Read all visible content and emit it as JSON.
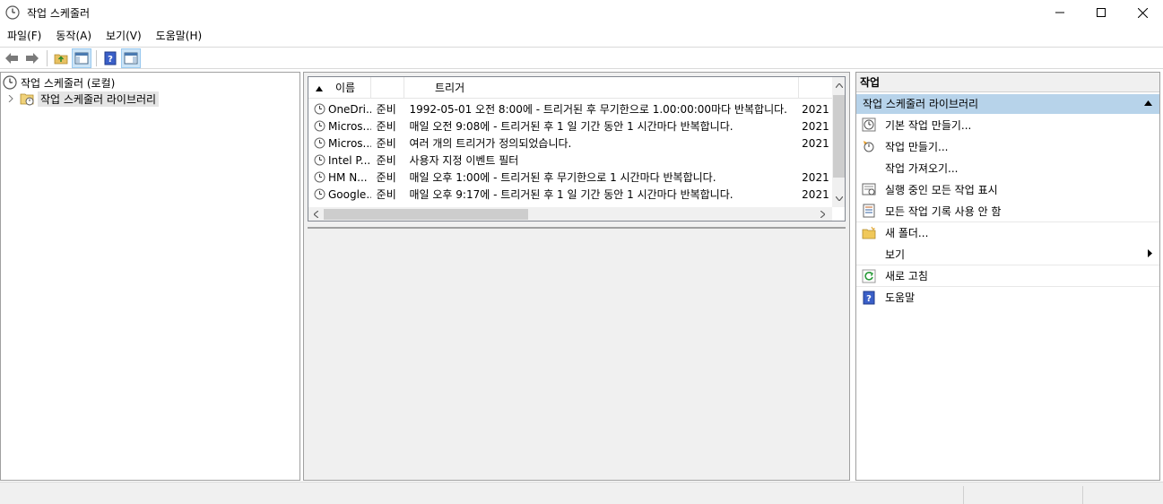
{
  "window": {
    "title": "작업 스케줄러",
    "icon": "clock-icon"
  },
  "menu": [
    "파일(F)",
    "동작(A)",
    "보기(V)",
    "도움말(H)"
  ],
  "toolbar": {
    "buttons": [
      "back-arrow-icon",
      "forward-arrow-icon",
      "up-folder-icon",
      "show-hide-tree-icon",
      "help-icon",
      "show-hide-action-pane-icon"
    ]
  },
  "tree": {
    "root": "작업 스케줄러 (로컬)",
    "library": "작업 스케줄러 라이브러리"
  },
  "task_list": {
    "columns": [
      "이름",
      "트리거"
    ],
    "rows": [
      {
        "name": "OneDri...",
        "status": "준비",
        "trigger": "1992-05-01 오전 8:00에 - 트리거된 후 무기한으로 1.00:00:00마다 반복합니다.",
        "next": "2021"
      },
      {
        "name": "Micros...",
        "status": "준비",
        "trigger": "매일 오전 9:08에 - 트리거된 후 1 일 기간 동안 1 시간마다 반복합니다.",
        "next": "2021"
      },
      {
        "name": "Micros...",
        "status": "준비",
        "trigger": "여러 개의 트리거가 정의되었습니다.",
        "next": "2021"
      },
      {
        "name": "Intel P...",
        "status": "준비",
        "trigger": "사용자 지정 이벤트 필터",
        "next": ""
      },
      {
        "name": "HM N...",
        "status": "준비",
        "trigger": "매일 오후 1:00에 - 트리거된 후 무기한으로 1 시간마다 반복합니다.",
        "next": "2021"
      },
      {
        "name": "Google...",
        "status": "준비",
        "trigger": "매일 오후 9:17에 - 트리거된 후 1 일 기간 동안 1 시간마다 반복합니다.",
        "next": "2021"
      }
    ]
  },
  "actions": {
    "header": "작업",
    "section": "작업 스케줄러 라이브러리",
    "items": [
      {
        "label": "기본 작업 만들기...",
        "icon": "basic-task-icon"
      },
      {
        "label": "작업 만들기...",
        "icon": "create-task-icon"
      },
      {
        "label": "작업 가져오기...",
        "icon": ""
      },
      {
        "label": "실행 중인 모든 작업 표시",
        "icon": "running-tasks-icon"
      },
      {
        "label": "모든 작업 기록 사용 안 함",
        "icon": "history-icon"
      },
      {
        "label": "새 폴더...",
        "icon": "new-folder-icon"
      },
      {
        "label": "보기",
        "icon": ""
      },
      {
        "label": "새로 고침",
        "icon": "refresh-icon"
      },
      {
        "label": "도움말",
        "icon": "help-icon"
      }
    ]
  },
  "colors": {
    "section_bg": "#b7d3ea",
    "toolbar_selected": "#cce4f7"
  }
}
